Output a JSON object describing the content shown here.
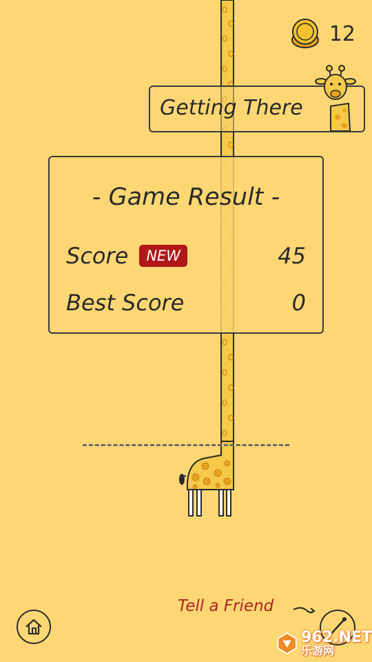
{
  "coins": {
    "count": "12",
    "icon": "coin-stack-icon"
  },
  "rank": {
    "title": "Getting There",
    "icon": "giraffe-head-icon"
  },
  "result": {
    "title": "- Game Result -",
    "score_label": "Score",
    "new_badge": "NEW",
    "score_value": "45",
    "best_label": "Best Score",
    "best_value": "0"
  },
  "bottom": {
    "home_icon": "home-icon",
    "tell_friend": "Tell a Friend",
    "arrow_icon": "curved-arrow-icon",
    "share_icon": "share-icon"
  },
  "watermark": {
    "top": "962.NET",
    "bottom": "乐游网"
  },
  "colors": {
    "background": "#fcd774",
    "giraffe_body": "#f6c94a",
    "giraffe_spots": "#e8a21f",
    "outline": "#2a2a2a",
    "new_badge": "#b01818",
    "tell_friend": "#b02222"
  }
}
